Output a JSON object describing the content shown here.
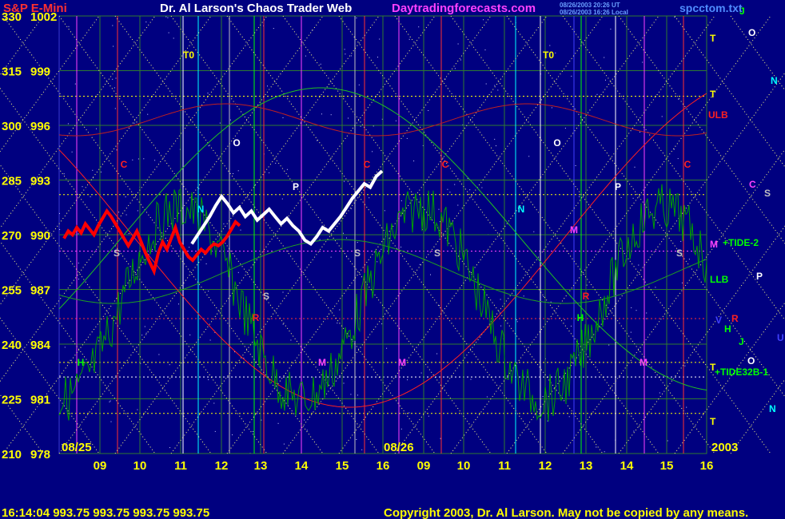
{
  "header": {
    "symbol": "S&P E-Mini",
    "title": "Dr. Al Larson's Chaos Trader Web",
    "site": "Daytradingforecasts.com",
    "stamp1": "08/26/2003 20:26 UT",
    "stamp2": "08/26/2003 16:26 Local",
    "file": "spcctom.txt",
    "colors": {
      "symbol": "#ff3030",
      "title": "#ffffff",
      "site": "#ff40ff",
      "stamp": "#6aa0ff",
      "file": "#4f8cff"
    }
  },
  "footer": {
    "quote": "16:14:04  993.75 993.75 993.75 993.75",
    "copyright": "Copyright 2003, Dr. Al Larson. May not be copied by any means."
  },
  "chart_data": {
    "type": "line",
    "y_left_labels": [
      "330",
      "315",
      "300",
      "285",
      "270",
      "255",
      "240",
      "225",
      "210"
    ],
    "y_right_labels": [
      "1002",
      "999",
      "996",
      "993",
      "990",
      "987",
      "984",
      "981",
      "978"
    ],
    "ylim": [
      978,
      1002
    ],
    "x_tick_labels": [
      "09",
      "10",
      "11",
      "12",
      "13",
      "14",
      "15",
      "16",
      "09",
      "10",
      "11",
      "12",
      "13",
      "14",
      "15",
      "16"
    ],
    "date_labels": [
      "08/25",
      "08/26"
    ],
    "year_label": "2003",
    "right_markers": [
      {
        "text": "T",
        "color": "#ffff00"
      },
      {
        "text": "O",
        "color": "#ffffff"
      },
      {
        "text": "N",
        "color": "#00ffff"
      },
      {
        "text": "T",
        "color": "#ffff00"
      },
      {
        "text": "ULB",
        "color": "#ff2020"
      },
      {
        "text": "C",
        "color": "#ff40ff"
      },
      {
        "text": "S",
        "color": "#c0c0c0"
      },
      {
        "text": "M",
        "color": "#ff40ff"
      },
      {
        "text": "+TIDE-2",
        "color": "#00ff00"
      },
      {
        "text": "LLB",
        "color": "#00ff00"
      },
      {
        "text": "P",
        "color": "#ffffff"
      },
      {
        "text": "V",
        "color": "#4040ff"
      },
      {
        "text": "R",
        "color": "#ff2020"
      },
      {
        "text": "H",
        "color": "#00ff00"
      },
      {
        "text": "J",
        "color": "#00ff00"
      },
      {
        "text": "U",
        "color": "#4040ff"
      },
      {
        "text": "O",
        "color": "#ffffff"
      },
      {
        "text": "T",
        "color": "#ffff00"
      },
      {
        "text": "+TIDE32B-1",
        "color": "#00ff00"
      },
      {
        "text": "N",
        "color": "#00ffff"
      },
      {
        "text": "T",
        "color": "#ffff00"
      },
      {
        "text": "J",
        "color": "#00ff00"
      }
    ],
    "in_chart_markers": [
      {
        "text": "T0",
        "color": "#ffff00"
      },
      {
        "text": "T0",
        "color": "#ffff00"
      },
      {
        "text": "O",
        "color": "#ffffff"
      },
      {
        "text": "O",
        "color": "#ffffff"
      },
      {
        "text": "C",
        "color": "#ff2020"
      },
      {
        "text": "C",
        "color": "#ff2020"
      },
      {
        "text": "C",
        "color": "#ff2020"
      },
      {
        "text": "C",
        "color": "#ff2020"
      },
      {
        "text": "N",
        "color": "#00ffff"
      },
      {
        "text": "N",
        "color": "#00ffff"
      },
      {
        "text": "P",
        "color": "#ffffff"
      },
      {
        "text": "P",
        "color": "#ffffff"
      },
      {
        "text": "S",
        "color": "#c0c0c0"
      },
      {
        "text": "S",
        "color": "#c0c0c0"
      },
      {
        "text": "S",
        "color": "#c0c0c0"
      },
      {
        "text": "S",
        "color": "#c0c0c0"
      },
      {
        "text": "S",
        "color": "#c0c0c0"
      },
      {
        "text": "R",
        "color": "#ff2020"
      },
      {
        "text": "R",
        "color": "#ff2020"
      },
      {
        "text": "H",
        "color": "#00ff00"
      },
      {
        "text": "H",
        "color": "#00ff00"
      },
      {
        "text": "M",
        "color": "#ff40ff"
      },
      {
        "text": "M",
        "color": "#ff40ff"
      },
      {
        "text": "M",
        "color": "#ff40ff"
      },
      {
        "text": "M",
        "color": "#ff40ff"
      },
      {
        "text": "V",
        "color": "#4040ff"
      },
      {
        "text": "V",
        "color": "#4040ff"
      }
    ],
    "series": [
      {
        "color": "#ff0000",
        "values": [
          989.8,
          990.2,
          990.0,
          990.4,
          990.1,
          990.6,
          990.3,
          990.0,
          990.5,
          990.9,
          991.3,
          991.0,
          990.6,
          990.2,
          989.8,
          989.4,
          989.8,
          990.2,
          989.6,
          989.0,
          988.5,
          988.0,
          989.0,
          989.6,
          989.2,
          989.8,
          990.4,
          989.6,
          989.2,
          988.8,
          988.6,
          988.9,
          989.2,
          989.0,
          989.3,
          989.5,
          989.4,
          989.6,
          989.9,
          990.3,
          990.7,
          990.5
        ]
      },
      {
        "color": "#ffffff",
        "values": [
          989.5,
          990.0,
          990.5,
          991.0,
          991.6,
          992.1,
          991.7,
          991.2,
          991.5,
          991.0,
          991.3,
          990.8,
          991.1,
          991.4,
          991.0,
          990.6,
          990.9,
          990.5,
          990.2,
          989.7,
          989.5,
          989.9,
          990.4,
          990.2,
          990.6,
          991.0,
          991.5,
          992.0,
          992.4,
          992.8,
          992.6,
          993.2,
          993.5
        ]
      }
    ]
  }
}
